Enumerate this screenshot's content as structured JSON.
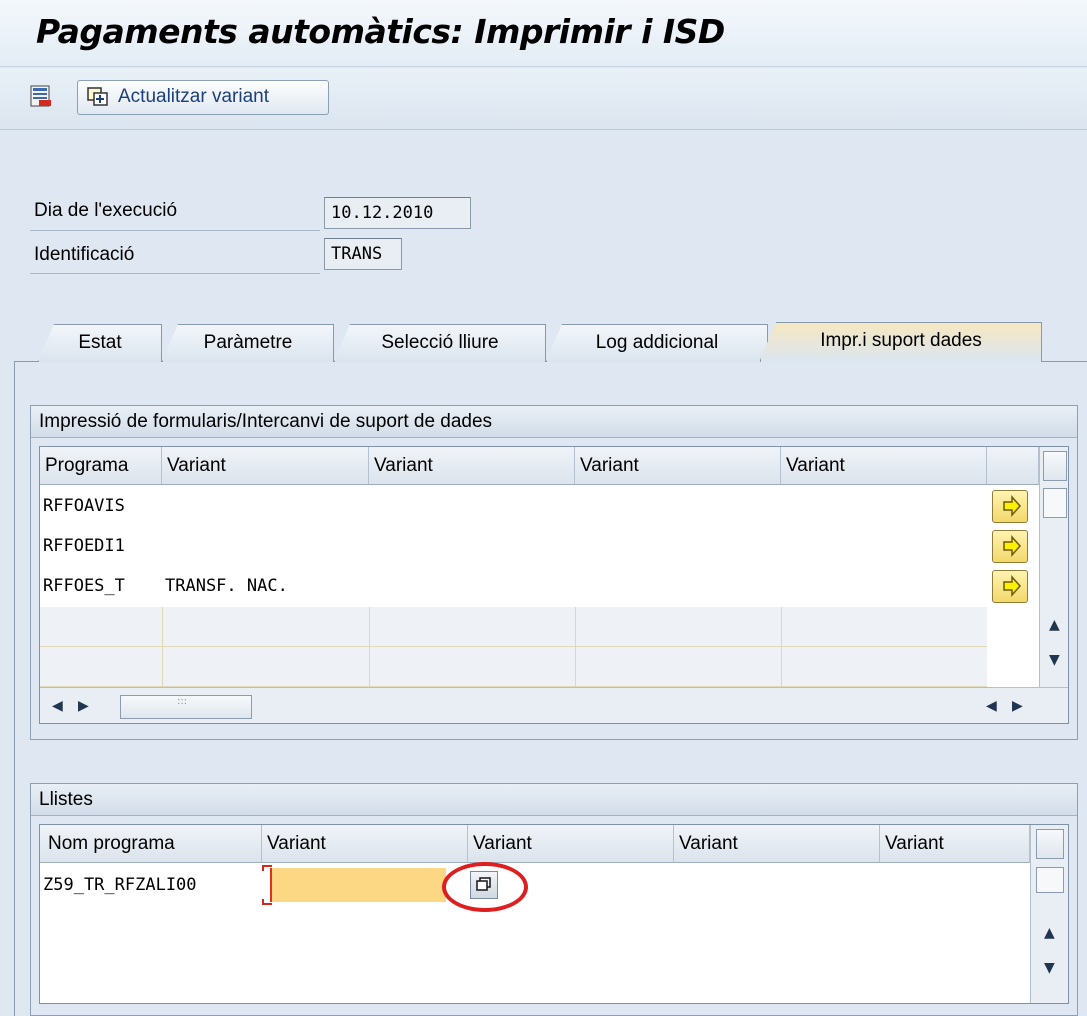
{
  "window": {
    "title": "Pagaments automàtics: Imprimir i ISD"
  },
  "toolbar": {
    "update_variant_label": "Actualitzar variant"
  },
  "header_fields": {
    "run_date_label": "Dia de l'execució",
    "run_date_value": "10.12.2010",
    "identification_label": "Identificació",
    "identification_value": "TRANS"
  },
  "tabs": [
    {
      "label": "Estat"
    },
    {
      "label": "Paràmetre"
    },
    {
      "label": "Selecció lliure"
    },
    {
      "label": "Log addicional"
    },
    {
      "label": "Impr.i suport dades"
    }
  ],
  "print_group": {
    "title": "Impressió de formularis/Intercanvi de suport de dades",
    "columns": [
      "Programa",
      "Variant",
      "Variant",
      "Variant",
      "Variant"
    ],
    "rows": [
      {
        "program": "RFFOAVIS",
        "variant": ""
      },
      {
        "program": "RFFOEDI1",
        "variant": ""
      },
      {
        "program": "RFFOES_T",
        "variant": "TRANSF. NAC."
      }
    ]
  },
  "lists_group": {
    "title": "Llistes",
    "columns": [
      "Nom programa",
      "Variant",
      "Variant",
      "Variant",
      "Variant"
    ],
    "rows": [
      {
        "program": "Z59_TR_RFZALI00",
        "variant": ""
      }
    ]
  },
  "colors": {
    "background": "#dfe8f2",
    "active_tab": "#f6e7c1",
    "input_focus": "#fcd784",
    "annotation": "#dd1f1f"
  }
}
